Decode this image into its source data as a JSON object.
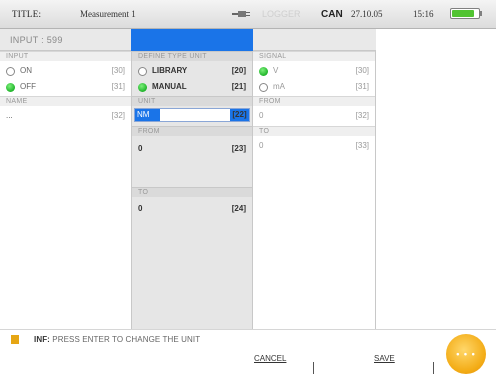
{
  "statusbar": {
    "title": "TITLE:",
    "measurement": "Measurement 1",
    "faded_label": "LOGGER",
    "can": "CAN",
    "date": "27.10.05",
    "time": "15:16",
    "battery_level": 0.85,
    "battery_color": "#52c432"
  },
  "header": {
    "input_label": "INPUT : 599",
    "accent_color": "#1a74e8"
  },
  "col1": {
    "input_section": "INPUT",
    "on_label": "ON",
    "on_code": "[30]",
    "off_label": "OFF",
    "off_code": "[31]",
    "name_section": "NAME",
    "name_value": "...",
    "name_code": "[32]"
  },
  "col2": {
    "define_section": "DEFINE TYPE UNIT",
    "library_label": "LIBRARY",
    "library_code": "[20]",
    "manual_label": "MANUAL",
    "manual_code": "[21]",
    "unit_section": "UNIT",
    "unit_value": "NM",
    "unit_code": "[22]",
    "from_section": "FROM",
    "from_value": "0",
    "from_code": "[23]",
    "to_section": "TO",
    "to_value": "0",
    "to_code": "[24]"
  },
  "col3": {
    "signal_section": "SIGNAL",
    "v_label": "V",
    "v_code": "[30]",
    "ma_label": "mA",
    "ma_code": "[31]",
    "from_section": "FROM",
    "from_value": "0",
    "from_code": "[32]",
    "to_section": "TO",
    "to_value": "0",
    "to_code": "[33]"
  },
  "info": {
    "prefix": "INF:",
    "message": "PRESS ENTER TO CHANGE THE UNIT"
  },
  "buttons": {
    "cancel": "CANCEL",
    "save": "SAVE",
    "nav_dots": "• • •"
  }
}
